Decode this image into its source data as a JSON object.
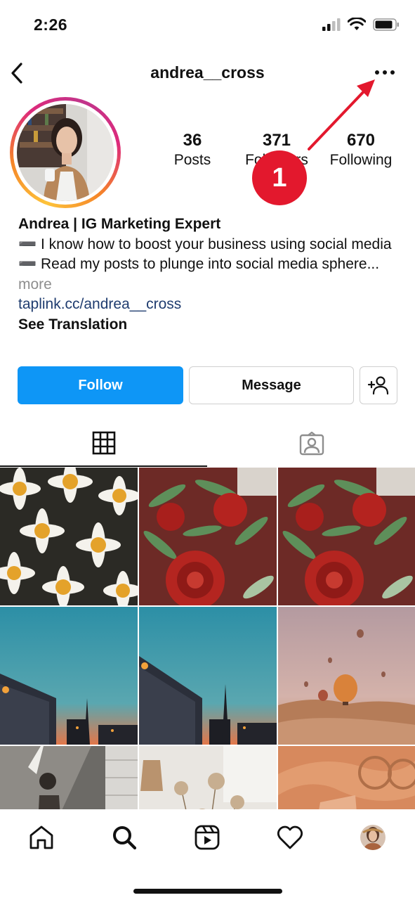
{
  "status_bar": {
    "time": "2:26"
  },
  "header": {
    "username": "andrea__cross"
  },
  "profile": {
    "stats": [
      {
        "value": "36",
        "label": "Posts"
      },
      {
        "value": "371",
        "label": "Followers"
      },
      {
        "value": "670",
        "label": "Following"
      }
    ]
  },
  "annotation": {
    "badge_number": "1",
    "color": "#e3182d"
  },
  "bio": {
    "name": "Andrea | IG Marketing Expert",
    "line1": "➖ I know how to boost your business using social media",
    "line2": "➖  Read my posts to plunge into social media sphere...",
    "more": "more",
    "link": "taplink.cc/andrea__cross",
    "translate": "See Translation"
  },
  "buttons": {
    "follow": "Follow",
    "message": "Message"
  },
  "colors": {
    "follow_blue": "#0e96f6",
    "link": "#1f3c6f",
    "annotation_red": "#e3182d"
  },
  "tabs": [
    "grid-icon",
    "tagged-icon"
  ],
  "posts": [
    "daisies",
    "red-roses",
    "red-roses",
    "city-sunset",
    "city-sunset",
    "hot-air-balloons",
    "girl-window",
    "dried-flowers",
    "peach-fabric"
  ],
  "bottom_nav": [
    "home-icon",
    "search-icon",
    "reels-icon",
    "heart-icon",
    "profile-avatar"
  ]
}
